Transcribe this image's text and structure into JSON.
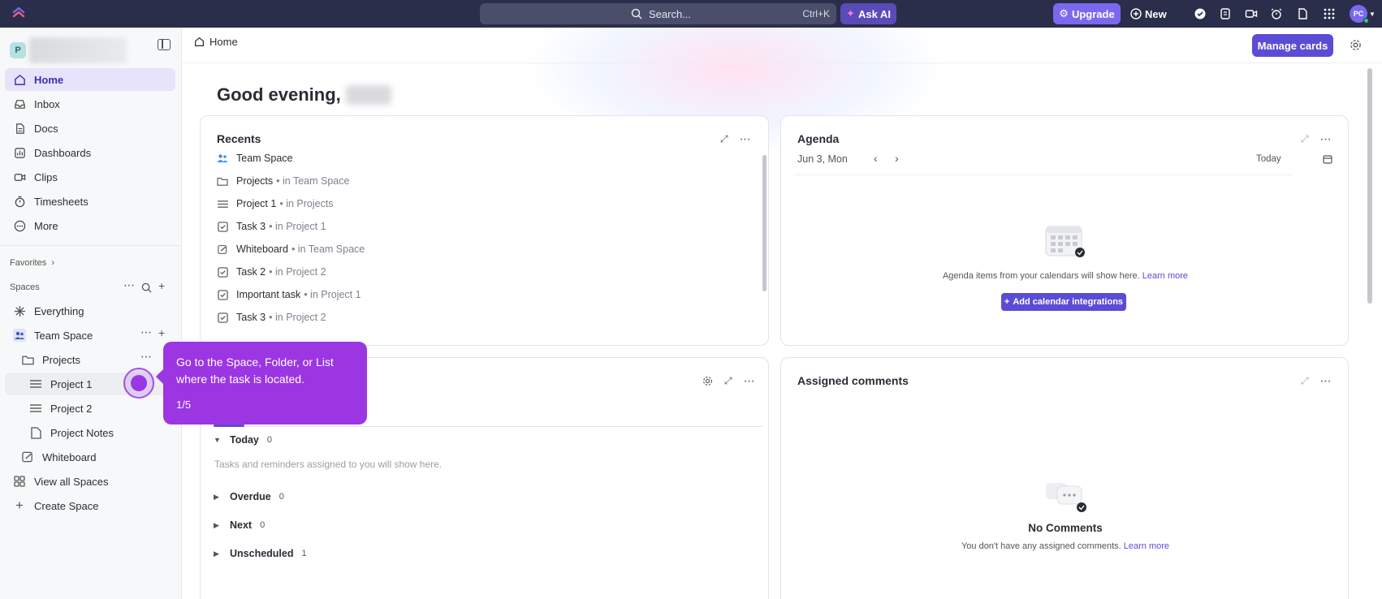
{
  "topbar": {
    "search_placeholder": "Search...",
    "search_shortcut": "Ctrl+K",
    "ask_ai": "Ask AI",
    "upgrade": "Upgrade",
    "new": "New",
    "avatar_initials": "PC"
  },
  "sidebar": {
    "workspace_initial": "P",
    "nav": [
      {
        "label": "Home"
      },
      {
        "label": "Inbox"
      },
      {
        "label": "Docs"
      },
      {
        "label": "Dashboards"
      },
      {
        "label": "Clips"
      },
      {
        "label": "Timesheets"
      },
      {
        "label": "More"
      }
    ],
    "favorites": "Favorites",
    "spaces": "Spaces",
    "tree": {
      "everything": "Everything",
      "team_space": "Team Space",
      "projects": "Projects",
      "project1": "Project 1",
      "project2": "Project 2",
      "project_notes": "Project Notes",
      "whiteboard": "Whiteboard",
      "view_all": "View all Spaces",
      "create": "Create Space"
    }
  },
  "main": {
    "breadcrumb": "Home",
    "manage_cards": "Manage cards",
    "greeting": "Good evening,",
    "recents": {
      "title": "Recents",
      "items": [
        {
          "name": "Team Space",
          "loc": ""
        },
        {
          "name": "Projects",
          "loc": "• in Team Space"
        },
        {
          "name": "Project 1",
          "loc": "• in Projects"
        },
        {
          "name": "Task 3",
          "loc": "• in Project 1"
        },
        {
          "name": "Whiteboard",
          "loc": "• in Team Space"
        },
        {
          "name": "Task 2",
          "loc": "• in Project 2"
        },
        {
          "name": "Important task",
          "loc": "• in Project 1"
        },
        {
          "name": "Task 3",
          "loc": "• in Project 2"
        }
      ]
    },
    "agenda": {
      "title": "Agenda",
      "date": "Jun 3, Mon",
      "today": "Today",
      "empty_text": "Agenda items from your calendars will show here.",
      "learn_more": "Learn more",
      "add_button": "Add calendar integrations"
    },
    "my_work": {
      "empty_text": "Tasks and reminders assigned to you will show here.",
      "groups": [
        {
          "label": "Today",
          "count": "0"
        },
        {
          "label": "Overdue",
          "count": "0"
        },
        {
          "label": "Next",
          "count": "0"
        },
        {
          "label": "Unscheduled",
          "count": "1"
        }
      ]
    },
    "assigned": {
      "title": "Assigned comments",
      "empty_title": "No Comments",
      "empty_text": "You don't have any assigned comments.",
      "learn_more": "Learn more"
    }
  },
  "tour": {
    "text": "Go to the Space, Folder, or List where the task is located.",
    "step": "1/5"
  },
  "colors": {
    "accent": "#5b4cd6",
    "tour": "#9b36e2",
    "topbar": "#2a2e4a"
  }
}
